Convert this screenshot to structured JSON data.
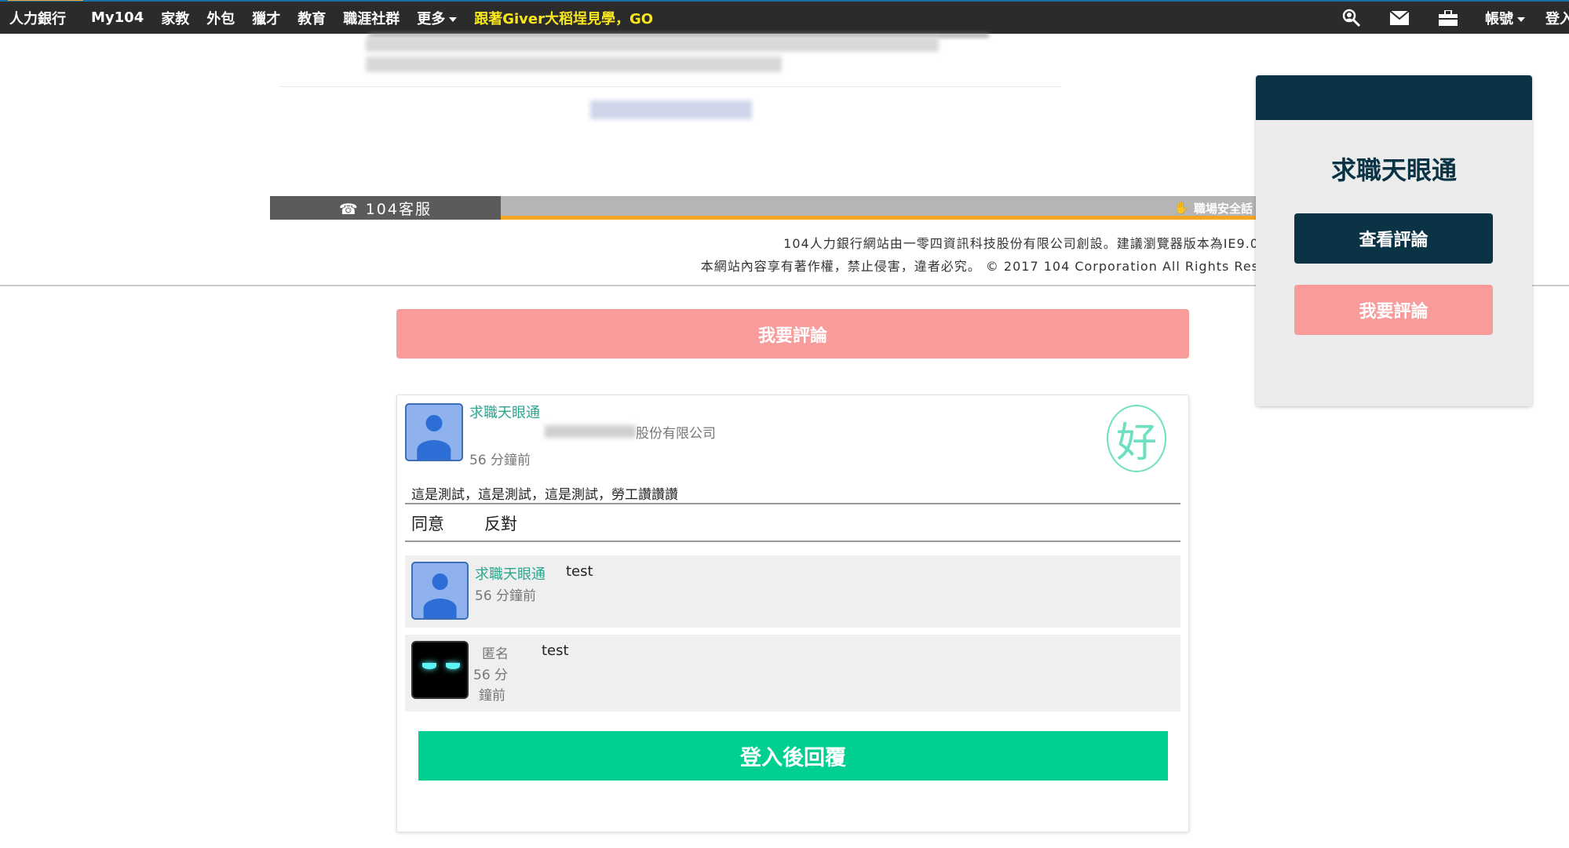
{
  "nav": {
    "brand": "人力銀行",
    "items": [
      "My104",
      "家教",
      "外包",
      "獵才",
      "教育",
      "職涯社群"
    ],
    "more": "更多",
    "promo": "跟著Giver大稻埕見學，GO",
    "account": "帳號",
    "login": "登入",
    "icons": [
      "search-person-icon",
      "mail-icon",
      "briefcase-icon"
    ]
  },
  "footer": {
    "service": "☎ 104客服",
    "safety": "職場安全話",
    "line1": "104人力銀行網站由一零四資訊科技股份有限公司創設。建議瀏覽器版本為IE9.0",
    "line2": "本網站內容享有著作權，禁止侵害，違者必究。 © 2017 104 Corporation All Rights Res"
  },
  "review_button": "我要評論",
  "post": {
    "author": "求職天眼通",
    "company_suffix": "股份有限公司",
    "time": "56 分鐘前",
    "badge": "好",
    "content": "這是測試，這是測試，這是測試，勞工讚讚讚",
    "agree": "同意",
    "oppose": "反對",
    "replies": [
      {
        "author": "求職天眼通",
        "text": "test",
        "time": "56 分鐘前"
      },
      {
        "author": "匿名",
        "text": "test",
        "time_a": "56 分",
        "time_b": "鐘前"
      }
    ],
    "login_reply": "登入後回覆"
  },
  "side": {
    "title": "求職天眼通",
    "view": "查看評論",
    "review": "我要評論"
  },
  "colors": {
    "nav_bg": "#2b2b2b",
    "promo": "#f8e71c",
    "pink": "#f79c9a",
    "green": "#00cf92",
    "navy": "#0b3346",
    "accent_green": "#2aa58e"
  }
}
